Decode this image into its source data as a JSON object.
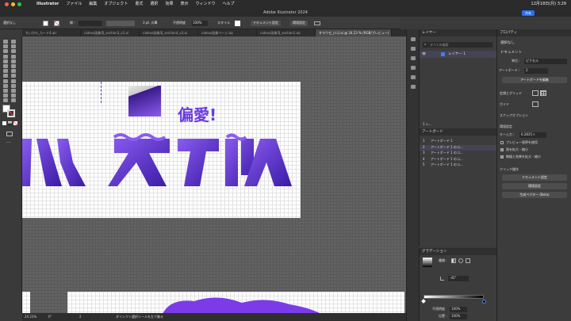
{
  "menubar": {
    "app": "Illustrator",
    "items": [
      "ファイル",
      "編集",
      "オブジェクト",
      "書式",
      "選択",
      "効果",
      "表示",
      "ウィンドウ",
      "ヘルプ"
    ],
    "datetime": "12月18日(月) 3:29"
  },
  "window": {
    "title": "Adobe Illustrator 2024",
    "share_label": "共有"
  },
  "control_bar": {
    "selection": "選択なし",
    "stroke_label": "線 :",
    "brush": "3 pt. 丸筆",
    "opacity_label": "不透明度",
    "opacity": "100%",
    "style_label": "スタイル",
    "doc_settings": "ドキュメント設定",
    "env_settings": "環境設定"
  },
  "tabs": [
    {
      "label": "ちいかわ_カード4.aic"
    },
    {
      "label": "cateus画像用_section3_v1.ai"
    },
    {
      "label": "cateus画像用_section4_v3.ai"
    },
    {
      "label": "cateus画像ページ.aic"
    },
    {
      "label": "cateus画像用_section1.aic"
    },
    {
      "label": "タマウゼ_ロゴ.ai @ 24.23 % (RGB/プレビュー)"
    }
  ],
  "artwork": {
    "tagline": "偏愛!",
    "logo_colors": {
      "start": "#8a5cf0",
      "end": "#3a1aa6"
    }
  },
  "status": {
    "zoom": "24.23%",
    "angle": "0°",
    "page": "2",
    "tool_hint": "ダイレクト選択ツールを左で触る"
  },
  "layers": {
    "tab": "レイヤー",
    "search_placeholder": "すべての検索",
    "items": [
      {
        "name": "レイヤー 1"
      }
    ],
    "count_label": "1 レ..."
  },
  "artboards": {
    "tab": "アートボード",
    "items": [
      {
        "num": "1",
        "name": "アートボード 1"
      },
      {
        "num": "2",
        "name": "アートボード 1 のコ..."
      },
      {
        "num": "3",
        "name": "アートボード 1 のコ..."
      },
      {
        "num": "4",
        "name": "アートボード 1 のコ..."
      },
      {
        "num": "5",
        "name": "アートボード 1 のコ..."
      }
    ]
  },
  "gradient": {
    "tab": "グラデーション",
    "type_label": "種類 :",
    "angle": "-45°",
    "opacity_label": "不透明度",
    "opacity": "100%",
    "location_label": "位置 :",
    "location": "100%"
  },
  "properties": {
    "tab": "プロパティ",
    "selection": "選択なし",
    "document_label": "ドキュメント",
    "unit_label": "単位 :",
    "unit": "ピクセル",
    "artboard_label": "アートボード :",
    "artboard_value": "2",
    "edit_artboards": "アートボードを編集",
    "rulers_grids": "定規とグリッド",
    "guides": "ガイド",
    "snap_options": "スナップオプション",
    "preferences": "環境設定",
    "keyboard_increment_label": "キー入力 :",
    "keyboard_increment": "0.2835 s",
    "preview_bounds": "プレビュー境界を使用",
    "scale_corners": "角を拡大・縮小",
    "scale_strokes": "線幅と効果を拡大・縮小",
    "quick_actions": "クイック操作",
    "doc_settings_btn": "ドキュメント設定",
    "prefs_btn": "環境設定",
    "vector_btn": "生成ベクター (Beta)"
  }
}
